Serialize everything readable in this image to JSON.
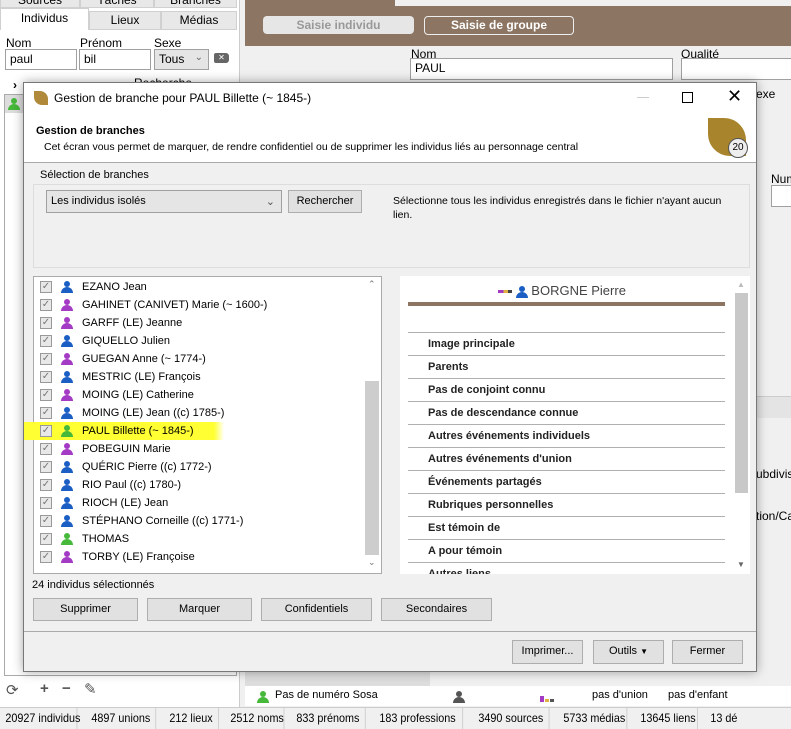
{
  "left_panel": {
    "tabs_top": [
      "Sources",
      "Tâches",
      "Branches"
    ],
    "tabs": [
      "Individus",
      "Lieux",
      "Médias"
    ],
    "nom_label": "Nom",
    "nom_value": "paul",
    "prenom_label": "Prénom",
    "prenom_value": "bil",
    "sexe_label": "Sexe",
    "sexe_value": "Tous",
    "advanced_search": "Recherche avancée"
  },
  "main": {
    "btn_individu": "Saisie individu",
    "btn_groupe": "Saisie de groupe",
    "nom_label": "Nom",
    "nom_value": "PAUL",
    "qualite_label": "Qualité",
    "sexe_label_partial": "exe",
    "num_label_partial": "Num",
    "subdivision_partial": "ubdivisi",
    "cause_partial": "tion/Cau",
    "sosa": "Pas de numéro Sosa",
    "union": "pas d'union",
    "enfant": "pas d'enfant"
  },
  "status_bar": [
    "20927 individus",
    "4897 unions",
    "212 lieux",
    "2512 noms",
    "833 prénoms",
    "183  professions",
    "3490 sources",
    "5733  médias",
    "13645 liens",
    "13 dé"
  ],
  "dialog": {
    "title": "Gestion de branche pour PAUL Billette (~ 1845-)",
    "header_title": "Gestion de branches",
    "header_desc": "Cet écran vous permet de marquer, de rendre confidentiel ou de supprimer les individus liés au personnage central",
    "badge": "20",
    "group_label": "Sélection de branches",
    "select_value": "Les individus isolés",
    "search_button": "Rechercher",
    "select_desc": "Sélectionne tous les individus enregistrés dans le fichier n'ayant aucun lien.",
    "individuals": [
      {
        "name": "EZANO Jean",
        "sex": "m"
      },
      {
        "name": "GAHINET (CANIVET) Marie (~ 1600-)",
        "sex": "f"
      },
      {
        "name": "GARFF (LE) Jeanne",
        "sex": "f"
      },
      {
        "name": "GIQUELLO Julien",
        "sex": "m"
      },
      {
        "name": "GUEGAN Anne (~ 1774-)",
        "sex": "f"
      },
      {
        "name": "MESTRIC (LE) François",
        "sex": "m"
      },
      {
        "name": "MOING (LE) Catherine",
        "sex": "f"
      },
      {
        "name": "MOING (LE) Jean ((c) 1785-)",
        "sex": "m"
      },
      {
        "name": "PAUL Billette (~ 1845-)",
        "sex": "u",
        "highlighted": true
      },
      {
        "name": "POBEGUIN Marie",
        "sex": "f"
      },
      {
        "name": "QUÉRIC Pierre ((c) 1772-)",
        "sex": "m"
      },
      {
        "name": "RIO Paul ((c) 1780-)",
        "sex": "m"
      },
      {
        "name": "RIOCH (LE) Jean",
        "sex": "m"
      },
      {
        "name": "STÉPHANO Corneille ((c) 1771-)",
        "sex": "m"
      },
      {
        "name": "THOMAS",
        "sex": "u"
      },
      {
        "name": "TORBY (LE) Françoise",
        "sex": "f"
      }
    ],
    "sex_colors": {
      "m": "#1c5fc4",
      "f": "#a43bc4",
      "u": "#46b83a"
    },
    "highlight_color": "#ffff33",
    "selected_count": "24 individus sélectionnés",
    "actions": [
      "Supprimer",
      "Marquer",
      "Confidentiels",
      "Secondaires"
    ],
    "detail_person": "BORGNE Pierre",
    "detail_sections": [
      "Image principale",
      "Parents",
      "Pas de conjoint connu",
      "Pas de descendance connue",
      "Autres événements individuels",
      "Autres événements d'union",
      "Événements partagés",
      "Rubriques personnelles",
      "Est témoin de",
      "A pour témoin",
      "Autres liens"
    ],
    "footer": {
      "print": "Imprimer...",
      "tools": "Outils",
      "close": "Fermer"
    }
  },
  "accent": "#8c7663"
}
